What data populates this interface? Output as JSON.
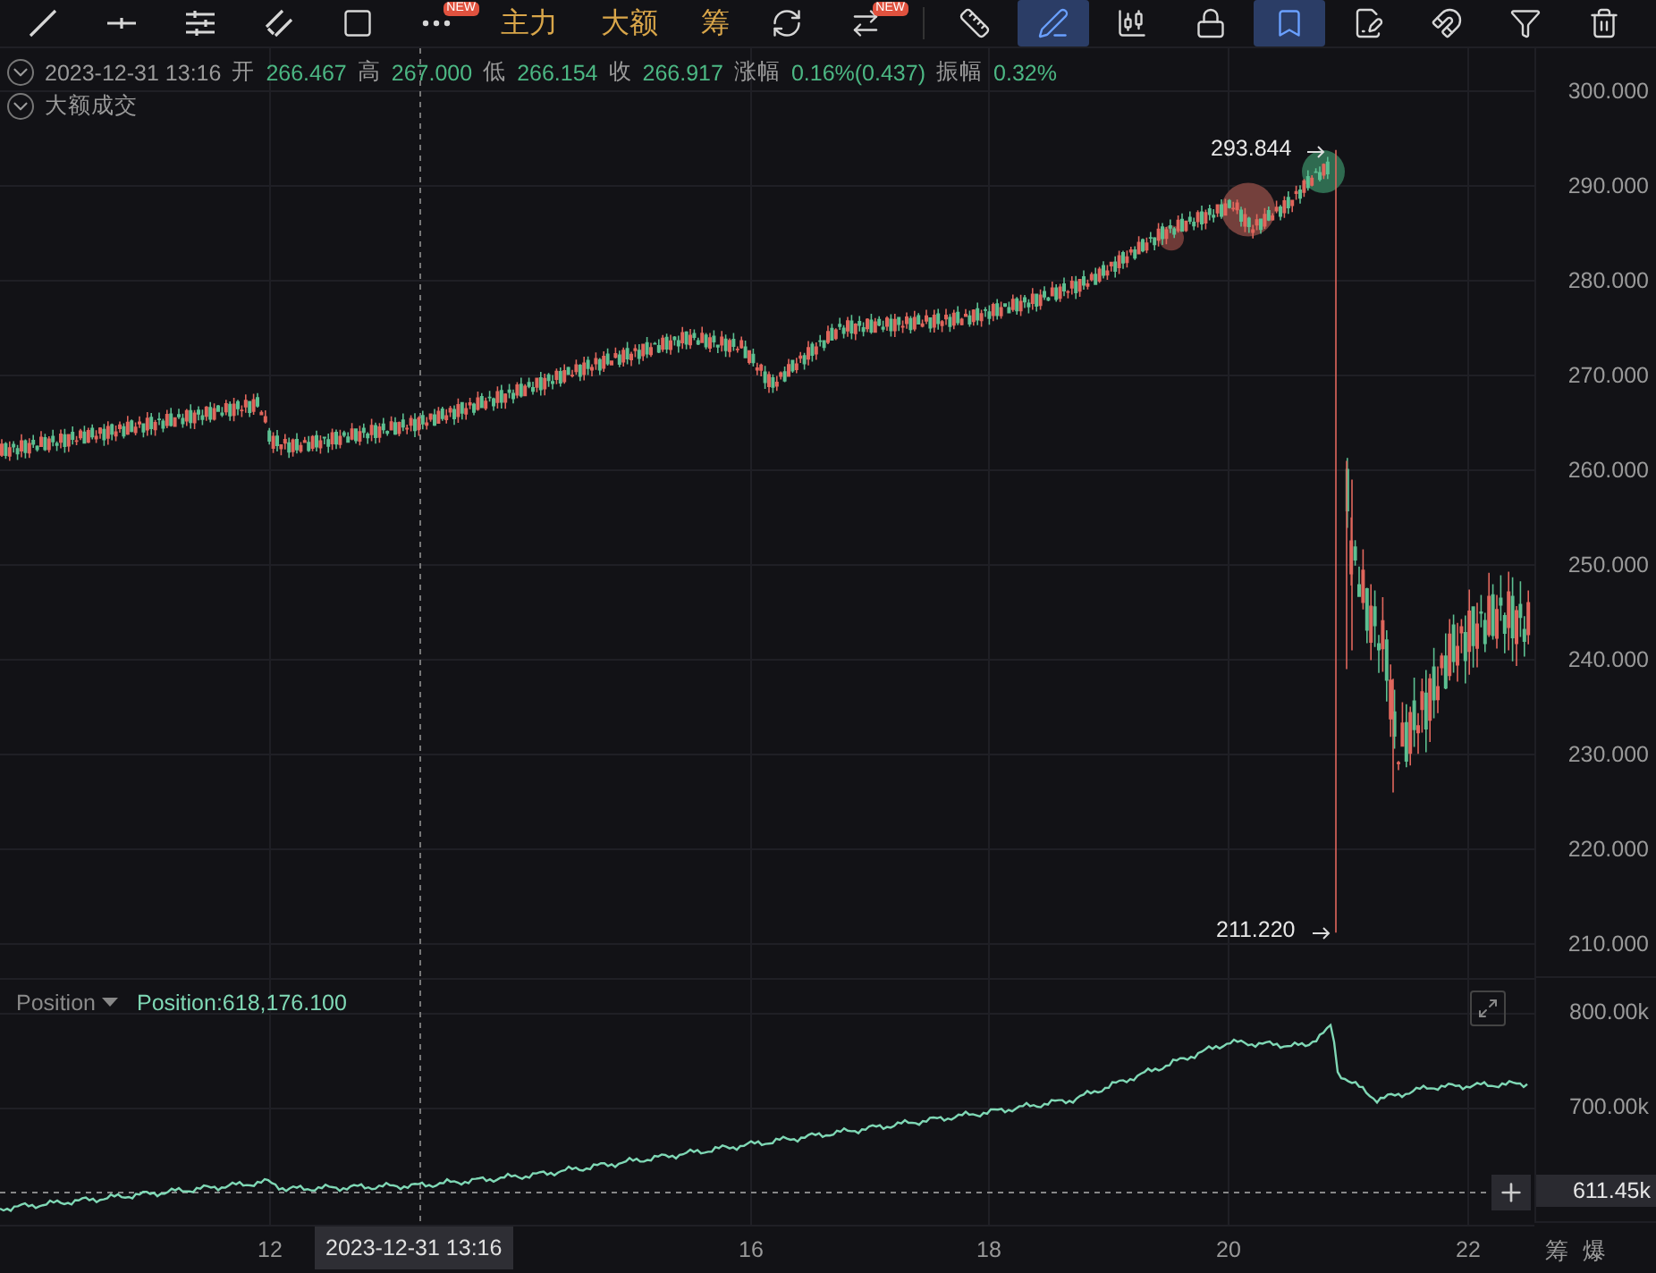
{
  "toolbar": {
    "items": [
      {
        "kind": "tool",
        "selected": false
      },
      {
        "kind": "tool",
        "selected": false
      },
      {
        "kind": "tool",
        "selected": false
      },
      {
        "kind": "tool",
        "selected": false
      },
      {
        "kind": "tool",
        "selected": false
      },
      {
        "kind": "tool",
        "selected": false,
        "badge": "NEW"
      },
      {
        "kind": "label",
        "label": "主力"
      },
      {
        "kind": "label",
        "label": "大额"
      },
      {
        "kind": "label",
        "label": "筹"
      },
      {
        "kind": "tool",
        "selected": false
      },
      {
        "kind": "tool",
        "selected": false,
        "badge": "NEW"
      },
      {
        "kind": "divider"
      },
      {
        "kind": "tool",
        "selected": false
      },
      {
        "kind": "tool",
        "selected": true
      },
      {
        "kind": "tool",
        "selected": false
      },
      {
        "kind": "tool",
        "selected": false
      },
      {
        "kind": "tool",
        "selected": true
      },
      {
        "kind": "tool",
        "selected": false
      },
      {
        "kind": "tool",
        "selected": false
      },
      {
        "kind": "tool",
        "selected": false
      },
      {
        "kind": "tool",
        "selected": false
      }
    ]
  },
  "legend": {
    "time": "2023-12-31 13:16",
    "fields": [
      {
        "label": "开",
        "value": "266.467"
      },
      {
        "label": "高",
        "value": "267.000"
      },
      {
        "label": "低",
        "value": "266.154"
      },
      {
        "label": "收",
        "value": "266.917"
      },
      {
        "label": "涨幅",
        "value": "0.16%(0.437)"
      },
      {
        "label": "振幅",
        "value": "0.32%"
      }
    ],
    "indicator": "大额成交"
  },
  "price_axis": [
    "300.000",
    "290.000",
    "280.000",
    "270.000",
    "260.000",
    "250.000",
    "240.000",
    "230.000",
    "220.000",
    "210.000"
  ],
  "high_marker": "293.844",
  "low_marker": "211.220",
  "position_pane": {
    "indicator": "Position",
    "reading": "Position:618,176.100",
    "axis": [
      "800.00k",
      "700.00k"
    ],
    "current": "611.45k"
  },
  "time_axis": {
    "labels": [
      "12",
      "16",
      "18",
      "20",
      "22"
    ],
    "crosshair": "2023-12-31 13:16"
  },
  "corner_buttons": [
    "筹",
    "爆"
  ]
}
